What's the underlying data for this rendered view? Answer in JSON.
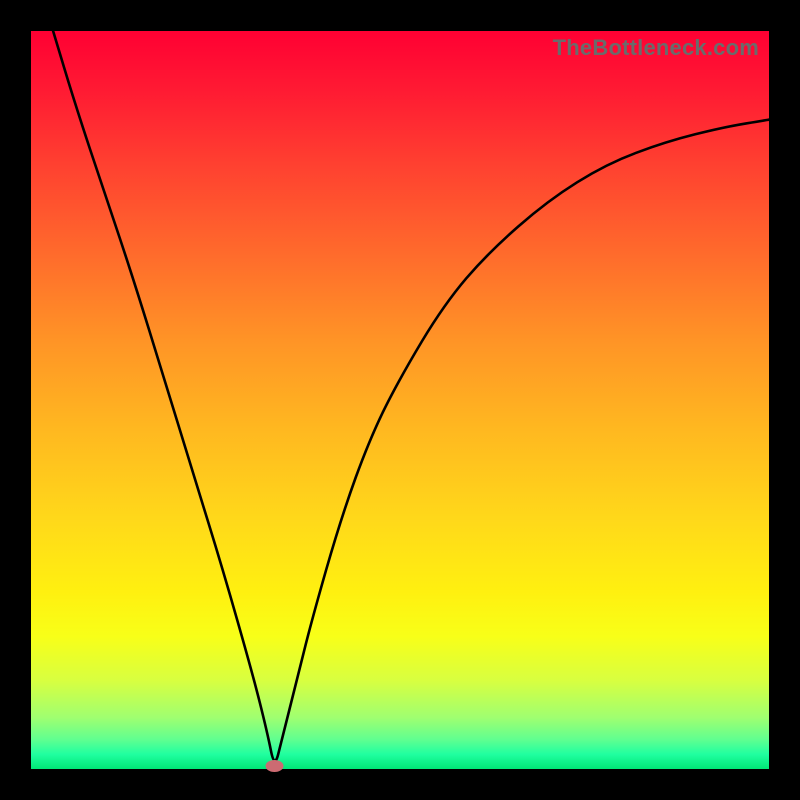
{
  "watermark": "TheBottleneck.com",
  "colors": {
    "frame": "#000000",
    "marker": "#cc6b72",
    "curve": "#000000",
    "gradient_top": "#ff0033",
    "gradient_bottom": "#00e676"
  },
  "chart_data": {
    "type": "line",
    "title": "",
    "xlabel": "",
    "ylabel": "",
    "xlim": [
      0,
      100
    ],
    "ylim": [
      0,
      100
    ],
    "minimum_point": {
      "x": 33,
      "y": 0
    },
    "has_axes_labels": false,
    "grid": false,
    "series": [
      {
        "name": "bottleneck-curve",
        "x": [
          3,
          6,
          10,
          14,
          18,
          22,
          26,
          30,
          32,
          33,
          34,
          36,
          38,
          42,
          46,
          50,
          56,
          62,
          70,
          78,
          86,
          94,
          100
        ],
        "y": [
          100,
          90,
          78,
          66,
          53,
          40,
          27,
          13,
          5,
          0,
          4,
          12,
          20,
          34,
          45,
          53,
          63,
          70,
          77,
          82,
          85,
          87,
          88
        ]
      }
    ],
    "annotations": [
      {
        "text": "TheBottleneck.com",
        "position": "top-right"
      }
    ]
  }
}
